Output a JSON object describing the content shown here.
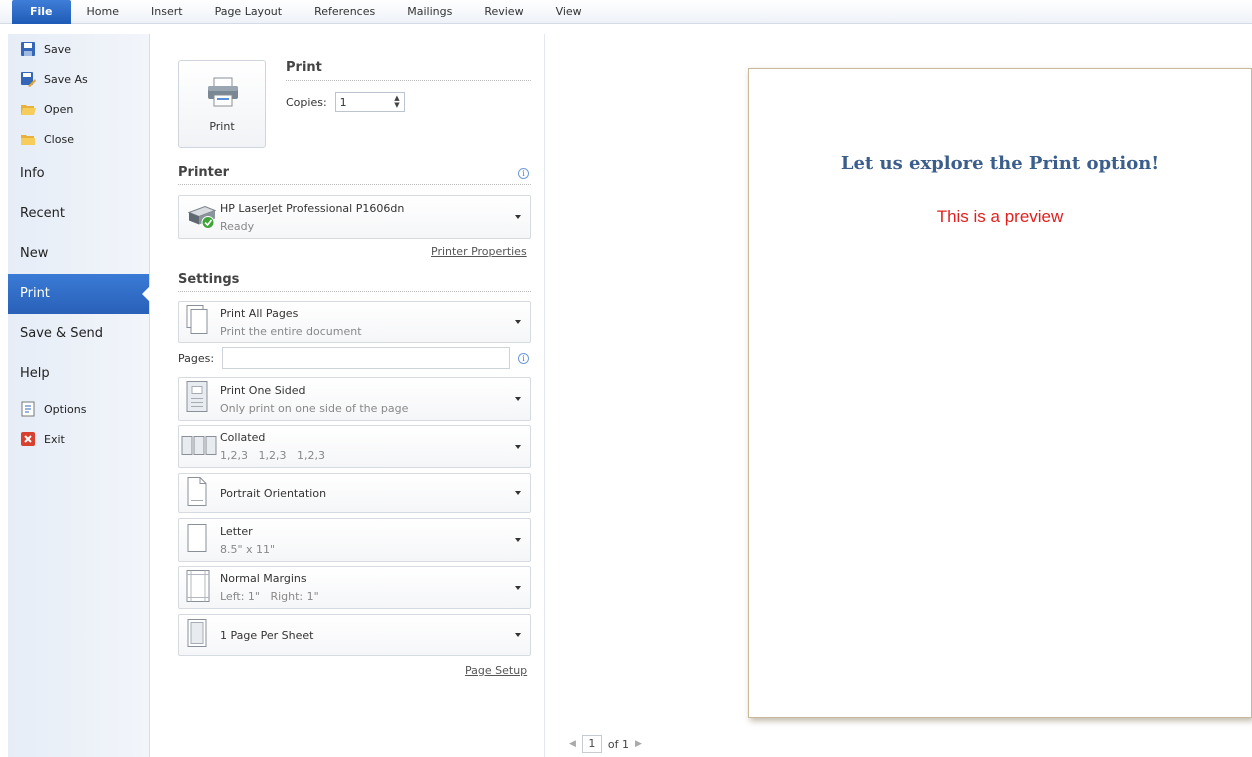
{
  "ribbon": {
    "tabs": [
      "File",
      "Home",
      "Insert",
      "Page Layout",
      "References",
      "Mailings",
      "Review",
      "View"
    ]
  },
  "nav": {
    "save": "Save",
    "save_as": "Save As",
    "open": "Open",
    "close": "Close",
    "info": "Info",
    "recent": "Recent",
    "new": "New",
    "print": "Print",
    "save_send": "Save & Send",
    "help": "Help",
    "options": "Options",
    "exit": "Exit"
  },
  "print": {
    "button_label": "Print",
    "heading": "Print",
    "copies_label": "Copies:",
    "copies_value": "1"
  },
  "printer": {
    "heading": "Printer",
    "name": "HP LaserJet Professional P1606dn",
    "status": "Ready",
    "properties_link": "Printer Properties"
  },
  "settings": {
    "heading": "Settings",
    "range": {
      "title": "Print All Pages",
      "subtitle": "Print the entire document"
    },
    "pages_label": "Pages:",
    "pages_value": "",
    "sides": {
      "title": "Print One Sided",
      "subtitle": "Only print on one side of the page"
    },
    "collation": {
      "title": "Collated",
      "subtitle": "1,2,3   1,2,3   1,2,3"
    },
    "orientation": {
      "title": "Portrait Orientation"
    },
    "paper": {
      "title": "Letter",
      "subtitle": "8.5\" x 11\""
    },
    "margins": {
      "title": "Normal Margins",
      "subtitle": "Left: 1\"   Right: 1\""
    },
    "per_sheet": {
      "title": "1 Page Per Sheet"
    },
    "page_setup_link": "Page Setup"
  },
  "preview": {
    "title": "Let us explore the Print option!",
    "subtitle": "This is a preview",
    "current_page": "1",
    "page_of": "of 1"
  },
  "colors": {
    "accent": "#2b63b9",
    "preview_title": "#3b5e8c",
    "preview_subtitle": "#e0201f"
  }
}
